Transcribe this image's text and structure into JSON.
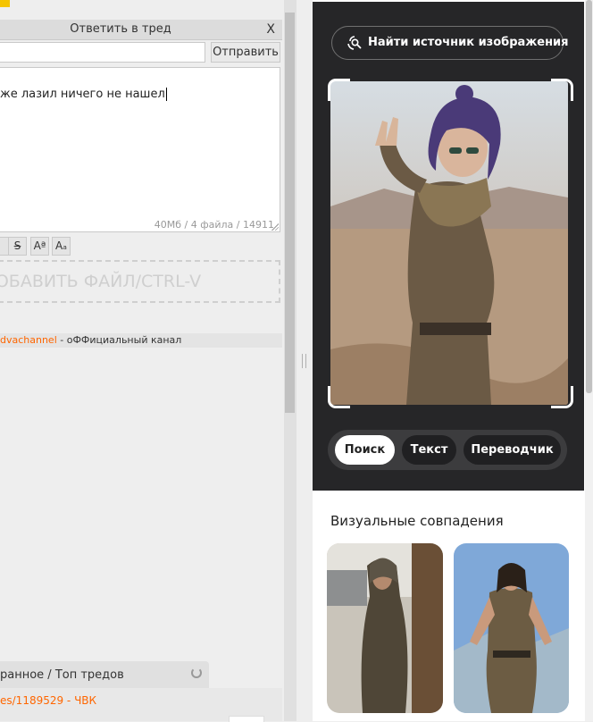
{
  "reply_form": {
    "title": "Ответить в тред",
    "close_label": "X",
    "send_label": "Отправить",
    "message_text": "же лазил ничего не нашел",
    "limits_text": "40Мб / 4 файла / 14911",
    "format_buttons": [
      "S",
      "Aª",
      "Aₐ"
    ],
    "dropzone_text": "ДОБАВИТЬ ФАЙЛ/CTRL-V",
    "channel_name": "dvachannel",
    "channel_suffix": " - оФФициальный канал"
  },
  "bookmarks": {
    "tabs_text": "ранное / Топ тредов",
    "thread_link": "es/1189529 - ЧВК"
  },
  "image_search": {
    "find_source_label": "Найти источник изображения",
    "tabs": [
      {
        "label": "Поиск",
        "active": true
      },
      {
        "label": "Текст",
        "active": false
      },
      {
        "label": "Переводчик",
        "active": false
      }
    ],
    "visual_matches_title": "Визуальные совпадения"
  },
  "colors": {
    "link_orange": "#ff6600",
    "panel_dark": "#262628",
    "accent_yellow": "#f5c400"
  }
}
